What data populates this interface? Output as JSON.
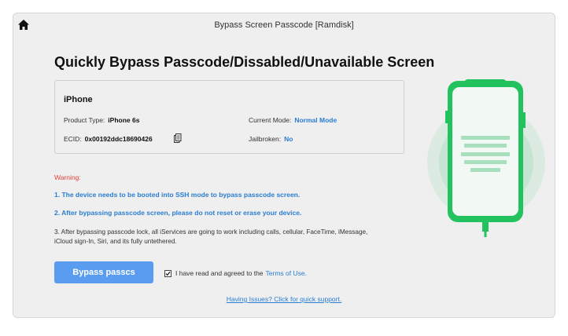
{
  "window": {
    "title": "Bypass Screen Passcode [Ramdisk]"
  },
  "heading": "Quickly Bypass Passcode/Dissabled/Unavailable Screen",
  "device": {
    "name": "iPhone",
    "product_type_label": "Product Type:",
    "product_type_value": "iPhone 6s",
    "current_mode_label": "Current Mode:",
    "current_mode_value": "Normal Mode",
    "ecid_label": "ECID:",
    "ecid_value": "0x00192ddc18690426",
    "jailbroken_label": "Jailbroken:",
    "jailbroken_value": "No"
  },
  "warning": {
    "title": "Warning:",
    "note1": "1. The device needs to be booted into SSH mode to bypass passcode screen.",
    "note2": "2. After bypassing passcode screen, please do not reset or erase your device.",
    "note3": "3. After bypassing passcode lock, all iServices are going to work including calls, cellular, FaceTime, iMessage, iCloud sign-In, Siri, and its fully untethered."
  },
  "actions": {
    "bypass_label": "Bypass passcs",
    "agree_text": "I have read and agreed to the",
    "terms_link": "Terms of Use.",
    "agree_checked": true
  },
  "support_link": "Having Issues? Click for quick support.",
  "colors": {
    "accent_blue": "#2a7dd2",
    "button_blue": "#5a9cf0",
    "warning_red": "#e0413b",
    "phone_green": "#22c35e"
  },
  "icons": {
    "home": "home-icon",
    "copy": "copy-icon",
    "check": "checkmark-icon",
    "phone": "phone-illustration"
  }
}
